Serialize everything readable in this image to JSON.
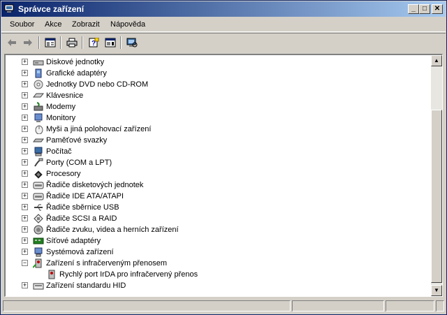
{
  "window": {
    "title": "Správce zařízení",
    "minimize_glyph": "_",
    "maximize_glyph": "□",
    "close_glyph": "✕"
  },
  "menu": [
    {
      "label": "Soubor"
    },
    {
      "label": "Akce"
    },
    {
      "label": "Zobrazit"
    },
    {
      "label": "Nápověda"
    }
  ],
  "toolbar": [
    {
      "icon": "back-arrow-icon"
    },
    {
      "icon": "forward-arrow-icon"
    },
    {
      "icon": "show-hide-console-tree-icon"
    },
    {
      "icon": "print-icon"
    },
    {
      "icon": "properties-icon"
    },
    {
      "icon": "help-icon"
    },
    {
      "icon": "scan-hardware-icon"
    }
  ],
  "tree": {
    "items": [
      {
        "label": "Diskové jednotky",
        "icon": "disk-drive-icon",
        "expander": "+",
        "level": 0
      },
      {
        "label": "Grafické adaptéry",
        "icon": "display-adapter-icon",
        "expander": "+",
        "level": 0
      },
      {
        "label": "Jednotky DVD nebo CD-ROM",
        "icon": "cdrom-icon",
        "expander": "+",
        "level": 0
      },
      {
        "label": "Klávesnice",
        "icon": "keyboard-icon",
        "expander": "+",
        "level": 0
      },
      {
        "label": "Modemy",
        "icon": "modem-icon",
        "expander": "+",
        "level": 0
      },
      {
        "label": "Monitory",
        "icon": "monitor-icon",
        "expander": "+",
        "level": 0
      },
      {
        "label": "Myši a jiná polohovací zařízení",
        "icon": "mouse-icon",
        "expander": "+",
        "level": 0
      },
      {
        "label": "Paměťové svazky",
        "icon": "storage-volume-icon",
        "expander": "+",
        "level": 0
      },
      {
        "label": "Počítač",
        "icon": "computer-icon",
        "expander": "+",
        "level": 0
      },
      {
        "label": "Porty (COM a LPT)",
        "icon": "port-icon",
        "expander": "+",
        "level": 0
      },
      {
        "label": "Procesory",
        "icon": "processor-icon",
        "expander": "+",
        "level": 0
      },
      {
        "label": "Řadiče disketových jednotek",
        "icon": "floppy-controller-icon",
        "expander": "+",
        "level": 0
      },
      {
        "label": "Řadiče IDE ATA/ATAPI",
        "icon": "ide-controller-icon",
        "expander": "+",
        "level": 0
      },
      {
        "label": "Řadiče sběrnice USB",
        "icon": "usb-icon",
        "expander": "+",
        "level": 0
      },
      {
        "label": "Řadiče SCSI a RAID",
        "icon": "scsi-icon",
        "expander": "+",
        "level": 0
      },
      {
        "label": "Řadiče zvuku, videa a herních zařízení",
        "icon": "sound-icon",
        "expander": "+",
        "level": 0
      },
      {
        "label": "Síťové adaptéry",
        "icon": "network-adapter-icon",
        "expander": "+",
        "level": 0
      },
      {
        "label": "Systémová zařízení",
        "icon": "system-device-icon",
        "expander": "+",
        "level": 0
      },
      {
        "label": "Zařízení s infračerveným přenosem",
        "icon": "infrared-icon",
        "expander": "−",
        "level": 0
      },
      {
        "label": "Rychlý port IrDA pro infračervený přenos",
        "icon": "infrared-device-icon",
        "expander": "",
        "level": 1
      },
      {
        "label": "Zařízení standardu HID",
        "icon": "hid-icon",
        "expander": "+",
        "level": 0
      }
    ]
  },
  "scrollbar": {
    "up_glyph": "▲",
    "down_glyph": "▼"
  },
  "statusbar": {
    "panes": [
      "",
      "",
      "",
      ""
    ]
  },
  "colors": {
    "titlebar_start": "#0a246a",
    "titlebar_end": "#a6caf0",
    "face": "#d4d0c8"
  }
}
